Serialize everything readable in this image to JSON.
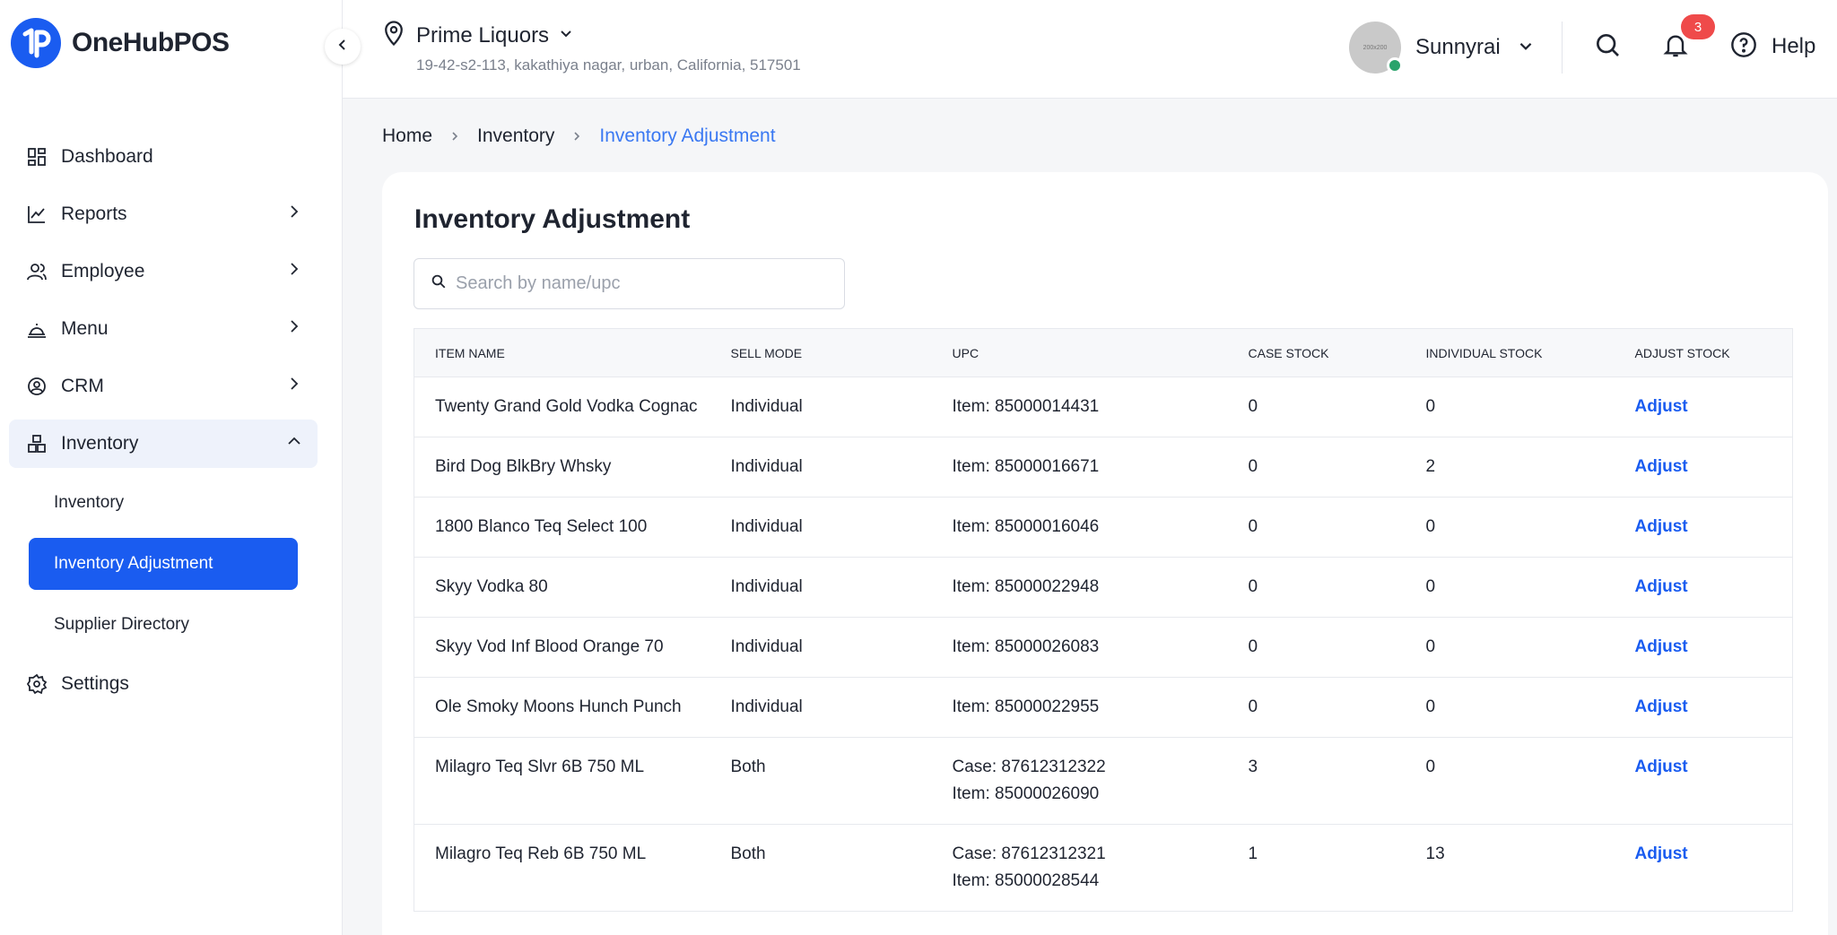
{
  "app": {
    "name": "OneHubPOS"
  },
  "sidebar": {
    "items": [
      {
        "label": "Dashboard",
        "icon": "dashboard-icon"
      },
      {
        "label": "Reports",
        "icon": "chart-line-icon"
      },
      {
        "label": "Employee",
        "icon": "users-icon"
      },
      {
        "label": "Menu",
        "icon": "cloche-icon"
      },
      {
        "label": "CRM",
        "icon": "crm-icon"
      },
      {
        "label": "Inventory",
        "icon": "boxes-icon"
      },
      {
        "label": "Settings",
        "icon": "gear-icon"
      }
    ],
    "inventory_sub": [
      {
        "label": "Inventory"
      },
      {
        "label": "Inventory Adjustment"
      },
      {
        "label": "Supplier Directory"
      }
    ]
  },
  "header": {
    "store_name": "Prime Liquors",
    "store_address": "19-42-s2-113, kakathiya nagar, urban, California, 517501",
    "user_name": "Sunnyrai",
    "avatar_placeholder": "200x200",
    "notifications_count": "3",
    "help_label": "Help"
  },
  "breadcrumb": {
    "home": "Home",
    "inventory": "Inventory",
    "current": "Inventory Adjustment"
  },
  "main": {
    "title": "Inventory Adjustment",
    "search_placeholder": "Search by name/upc"
  },
  "table": {
    "headers": {
      "item_name": "ITEM NAME",
      "sell_mode": "SELL MODE",
      "upc": "UPC",
      "case_stock": "CASE STOCK",
      "individual_stock": "INDIVIDUAL STOCK",
      "adjust_stock": "ADJUST STOCK"
    },
    "rows": [
      {
        "name": "Twenty Grand Gold Vodka Cognac",
        "mode": "Individual",
        "upc_line1": "Item: 85000014431",
        "upc_line2": "",
        "case": "0",
        "individual": "0",
        "action": "Adjust"
      },
      {
        "name": "Bird Dog BlkBry Whsky",
        "mode": "Individual",
        "upc_line1": "Item: 85000016671",
        "upc_line2": "",
        "case": "0",
        "individual": "2",
        "action": "Adjust"
      },
      {
        "name": "1800 Blanco Teq Select 100",
        "mode": "Individual",
        "upc_line1": "Item: 85000016046",
        "upc_line2": "",
        "case": "0",
        "individual": "0",
        "action": "Adjust"
      },
      {
        "name": "Skyy Vodka 80",
        "mode": "Individual",
        "upc_line1": "Item: 85000022948",
        "upc_line2": "",
        "case": "0",
        "individual": "0",
        "action": "Adjust"
      },
      {
        "name": "Skyy Vod Inf Blood Orange 70",
        "mode": "Individual",
        "upc_line1": "Item: 85000026083",
        "upc_line2": "",
        "case": "0",
        "individual": "0",
        "action": "Adjust"
      },
      {
        "name": "Ole Smoky Moons Hunch Punch",
        "mode": "Individual",
        "upc_line1": "Item: 85000022955",
        "upc_line2": "",
        "case": "0",
        "individual": "0",
        "action": "Adjust"
      },
      {
        "name": "Milagro Teq Slvr 6B 750 ML",
        "mode": "Both",
        "upc_line1": "Case: 87612312322",
        "upc_line2": "Item: 85000026090",
        "case": "3",
        "individual": "0",
        "action": "Adjust"
      },
      {
        "name": "Milagro Teq Reb 6B 750 ML",
        "mode": "Both",
        "upc_line1": "Case: 87612312321",
        "upc_line2": "Item: 85000028544",
        "case": "1",
        "individual": "13",
        "action": "Adjust"
      }
    ]
  },
  "colors": {
    "primary": "#1a5cf0",
    "link": "#3a78f2",
    "badge": "#ef4a4a",
    "online": "#2aa36b",
    "background": "#f5f6f8"
  }
}
